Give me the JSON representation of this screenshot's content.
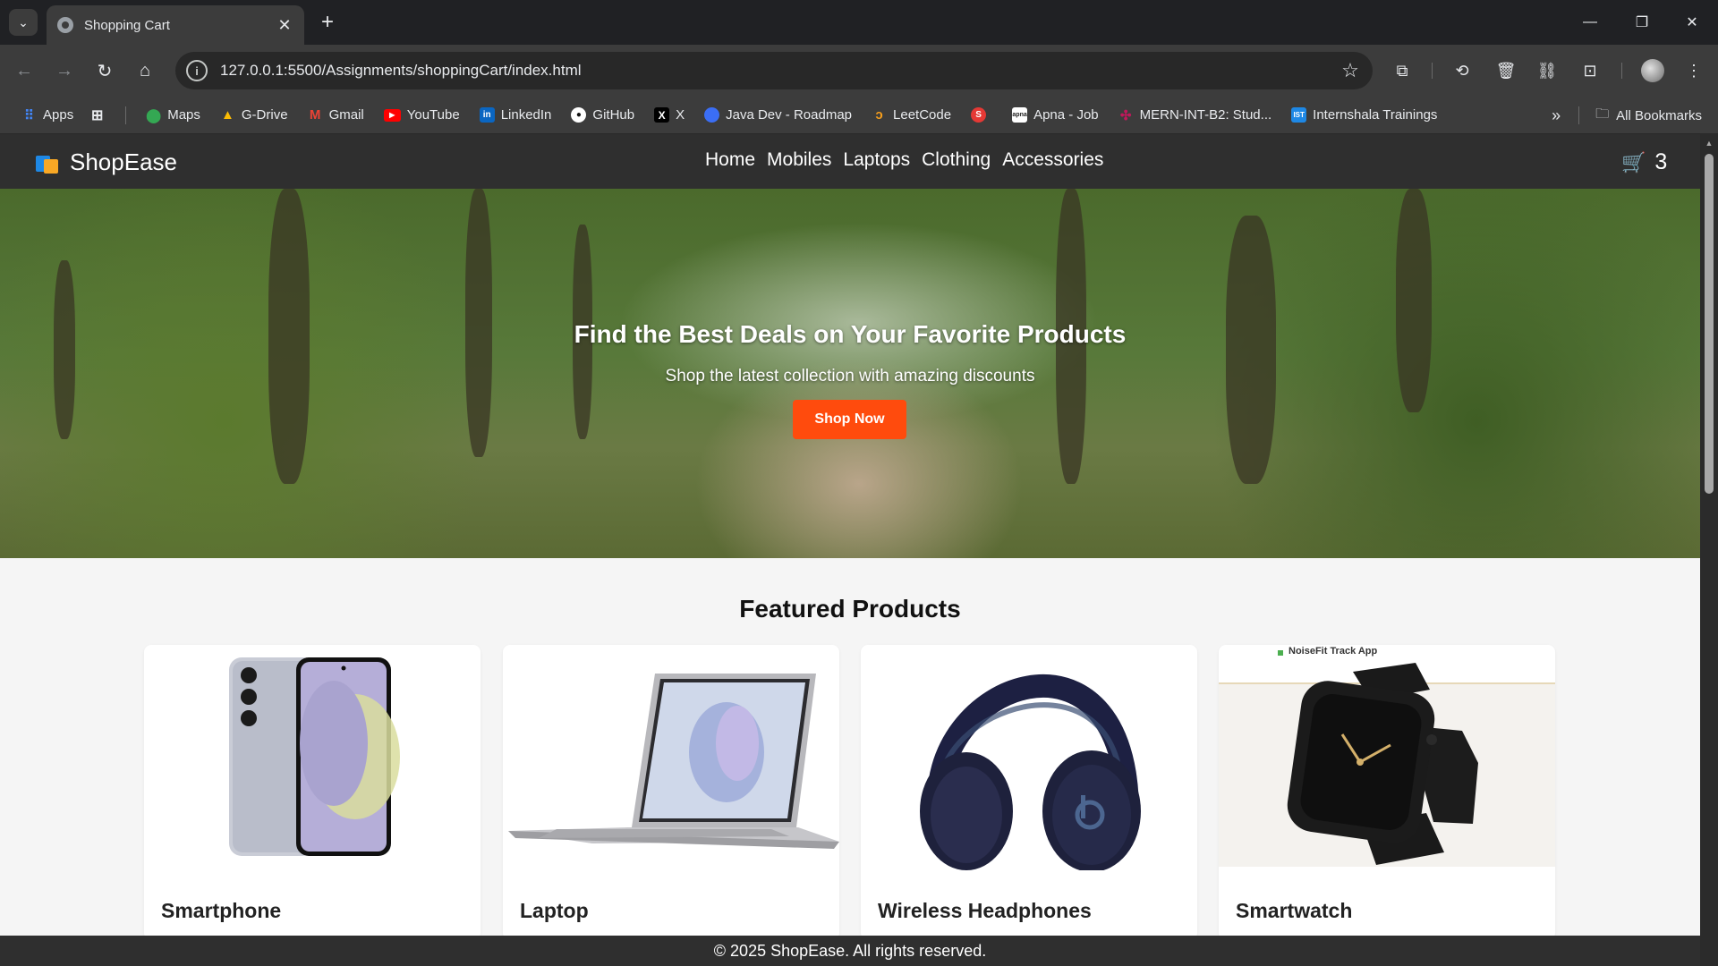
{
  "browser": {
    "tab_title": "Shopping Cart",
    "url": "127.0.0.1:5500/Assignments/shoppingCart/index.html",
    "bookmarks": [
      {
        "label": "Apps",
        "icon": "apps-grid-icon",
        "color": "#4285f4"
      },
      {
        "label": "Maps",
        "icon": "maps-icon",
        "color": "#34a853"
      },
      {
        "label": "G-Drive",
        "icon": "google-drive-icon",
        "color": "#fbbc04"
      },
      {
        "label": "Gmail",
        "icon": "gmail-icon",
        "color": "#ea4335"
      },
      {
        "label": "YouTube",
        "icon": "youtube-icon",
        "color": "#ff0000"
      },
      {
        "label": "LinkedIn",
        "icon": "linkedin-icon",
        "color": "#0a66c2"
      },
      {
        "label": "GitHub",
        "icon": "github-icon",
        "color": "#ffffff"
      },
      {
        "label": "X",
        "icon": "x-icon",
        "color": "#000000"
      },
      {
        "label": "Java Dev - Roadmap",
        "icon": "chat-bubble-icon",
        "color": "#3b6ef5"
      },
      {
        "label": "LeetCode",
        "icon": "leetcode-icon",
        "color": "#f89f1b"
      },
      {
        "label": "",
        "icon": "s-logo-icon",
        "color": "#e53935"
      },
      {
        "label": "Apna - Job",
        "icon": "apna-icon",
        "color": "#ffffff"
      },
      {
        "label": "MERN-INT-B2: Stud...",
        "icon": "slack-icon",
        "color": "#c2185b"
      },
      {
        "label": "Internshala Trainings",
        "icon": "internshala-icon",
        "color": "#1e88e5"
      }
    ],
    "all_bookmarks": "All Bookmarks"
  },
  "site": {
    "brand": "ShopEase",
    "nav": [
      "Home",
      "Mobiles",
      "Laptops",
      "Clothing",
      "Accessories"
    ],
    "cart_count": "3",
    "hero": {
      "title": "Find the Best Deals on Your Favorite Products",
      "subtitle": "Shop the latest collection with amazing discounts",
      "cta": "Shop Now",
      "cta_color": "#ff4b0d"
    },
    "featured_title": "Featured Products",
    "products": [
      {
        "name": "Smartphone",
        "image": "smartphone-image"
      },
      {
        "name": "Laptop",
        "image": "laptop-image"
      },
      {
        "name": "Wireless Headphones",
        "image": "headphones-image"
      },
      {
        "name": "Smartwatch",
        "image": "smartwatch-image",
        "image_caption": "NoiseFit Track App"
      }
    ],
    "footer": "© 2025 ShopEase. All rights reserved."
  }
}
